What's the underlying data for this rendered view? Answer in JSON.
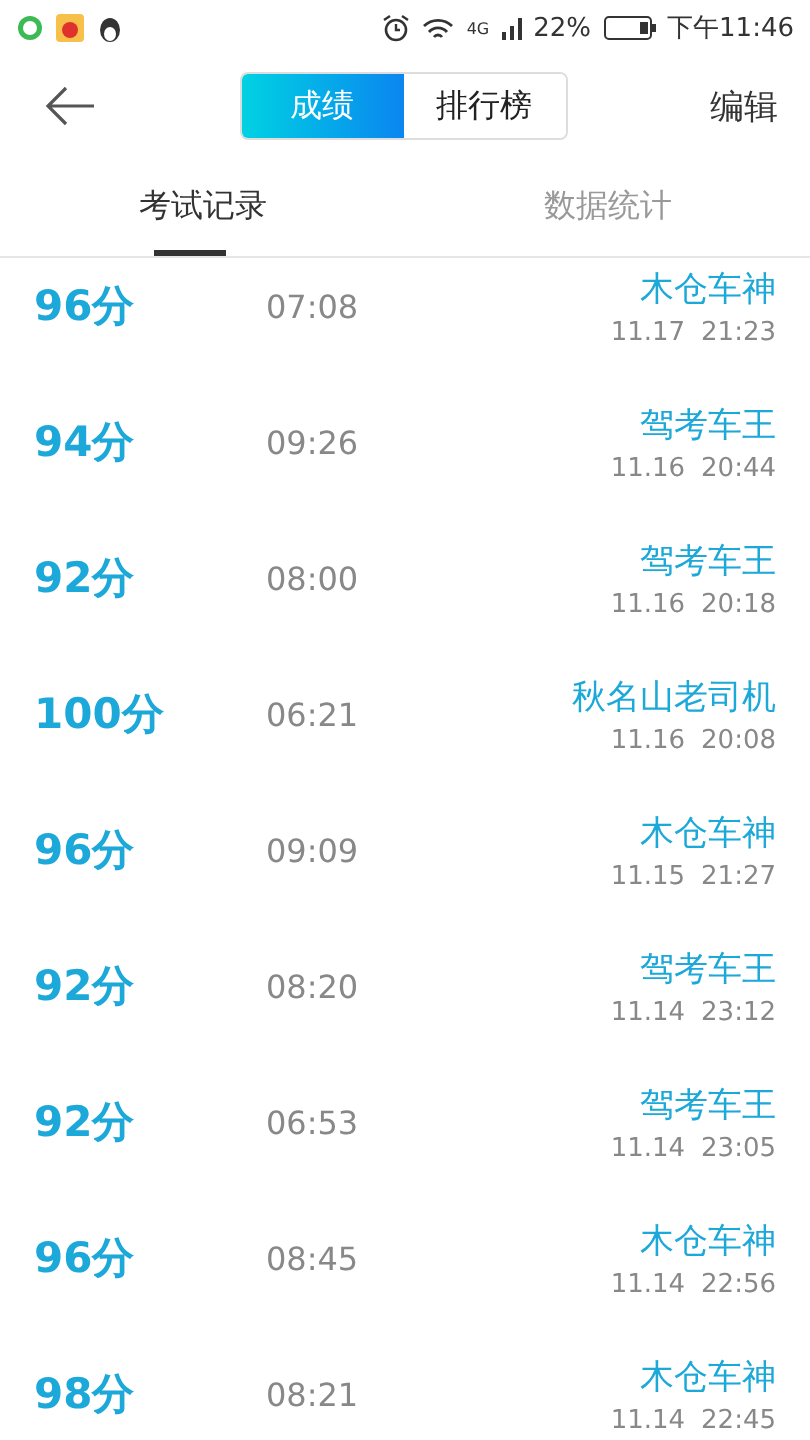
{
  "status_bar": {
    "network": "4G",
    "battery": "22%",
    "time": "下午11:46"
  },
  "header": {
    "segments": [
      {
        "label": "成绩",
        "selected": true
      },
      {
        "label": "排行榜",
        "selected": false
      }
    ],
    "action": "编辑"
  },
  "tabs": [
    {
      "label": "考试记录",
      "selected": true
    },
    {
      "label": "数据统计",
      "selected": false
    }
  ],
  "records": [
    {
      "score": "96分",
      "duration": "07:08",
      "title": "木仓车神",
      "date": "11.17",
      "time": "21:23"
    },
    {
      "score": "94分",
      "duration": "09:26",
      "title": "驾考车王",
      "date": "11.16",
      "time": "20:44"
    },
    {
      "score": "92分",
      "duration": "08:00",
      "title": "驾考车王",
      "date": "11.16",
      "time": "20:18"
    },
    {
      "score": "100分",
      "duration": "06:21",
      "title": "秋名山老司机",
      "date": "11.16",
      "time": "20:08"
    },
    {
      "score": "96分",
      "duration": "09:09",
      "title": "木仓车神",
      "date": "11.15",
      "time": "21:27"
    },
    {
      "score": "92分",
      "duration": "08:20",
      "title": "驾考车王",
      "date": "11.14",
      "time": "23:12"
    },
    {
      "score": "92分",
      "duration": "06:53",
      "title": "驾考车王",
      "date": "11.14",
      "time": "23:05"
    },
    {
      "score": "96分",
      "duration": "08:45",
      "title": "木仓车神",
      "date": "11.14",
      "time": "22:56"
    },
    {
      "score": "98分",
      "duration": "08:21",
      "title": "木仓车神",
      "date": "11.14",
      "time": "22:45"
    }
  ]
}
